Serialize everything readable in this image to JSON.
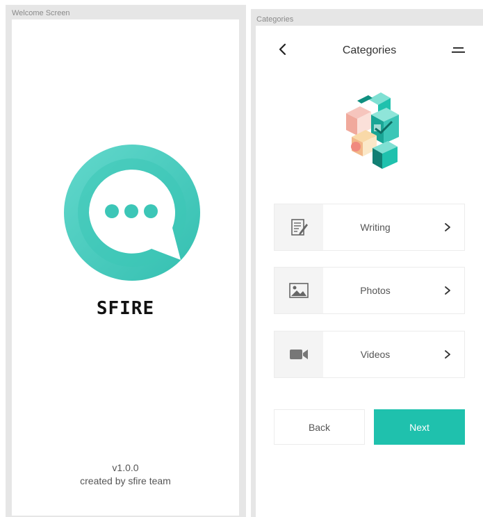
{
  "artboards": {
    "welcome_label": "Welcome Screen",
    "categories_label": "Categories"
  },
  "welcome": {
    "brand": "SFIRE",
    "version": "v1.0.0",
    "credit": "created by sfire team",
    "logo_icon": "chat-bubble-icon"
  },
  "categories": {
    "title": "Categories",
    "back_icon": "chevron-left-icon",
    "menu_icon": "menu-icon",
    "items": [
      {
        "label": "Writing",
        "icon": "document-edit-icon"
      },
      {
        "label": "Photos",
        "icon": "image-icon"
      },
      {
        "label": "Videos",
        "icon": "video-camera-icon"
      }
    ],
    "back_label": "Back",
    "next_label": "Next"
  },
  "colors": {
    "accent": "#1fc1ad",
    "teal_light": "#4fd3c4",
    "canvas": "#e6e6e6"
  }
}
